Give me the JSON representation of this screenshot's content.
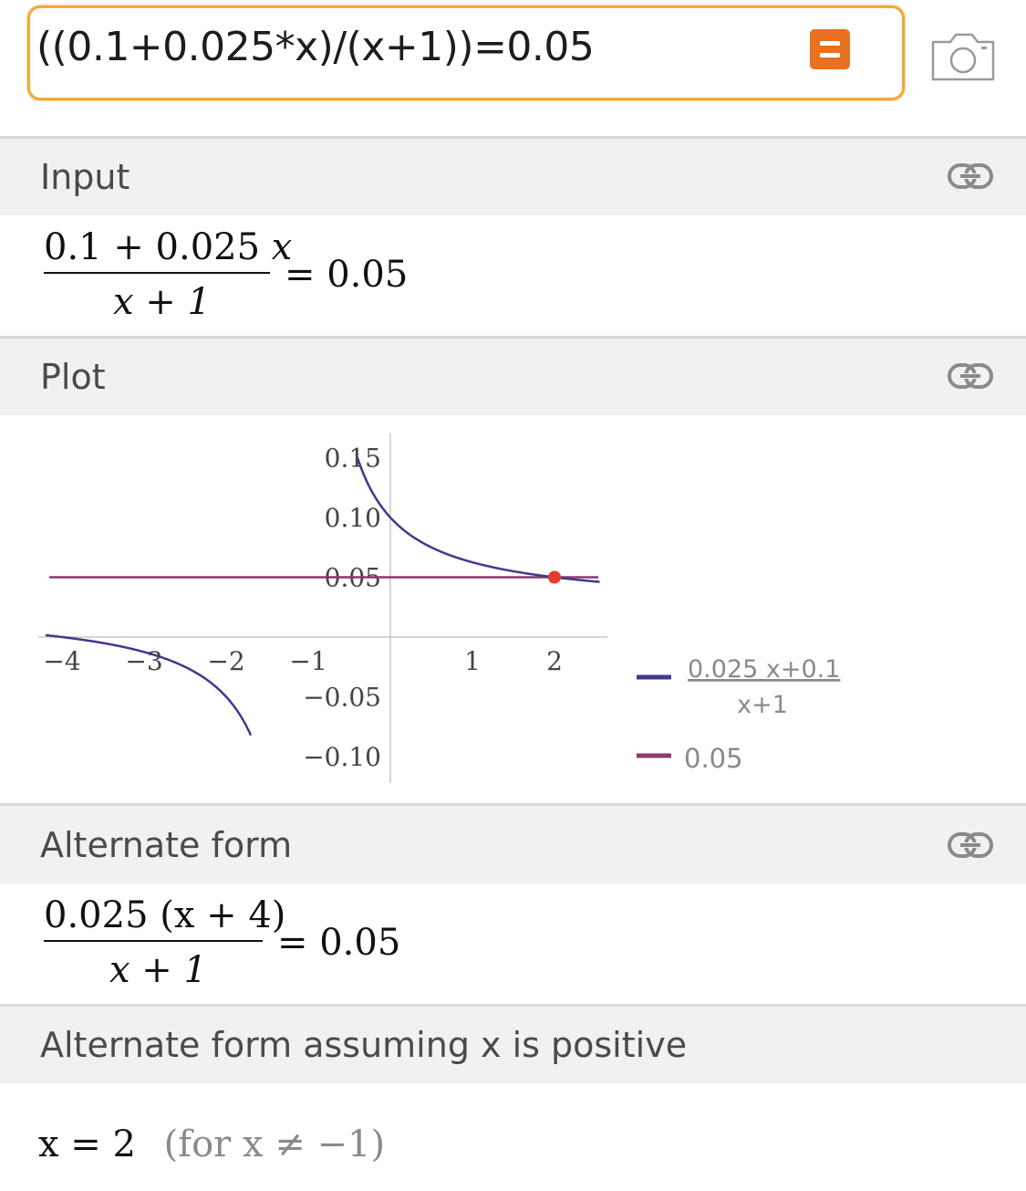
{
  "search": {
    "query": "((0.1+0.025*x)/(x+1))=0.05"
  },
  "pods": {
    "input": {
      "title": "Input",
      "numerator": "0.1 + 0.025",
      "numerator_var": "x",
      "denominator": "x + 1",
      "rhs": "= 0.05"
    },
    "plot": {
      "title": "Plot"
    },
    "alternate_form": {
      "title": "Alternate form",
      "numerator": "0.025 (x + 4)",
      "denominator": "x + 1",
      "rhs": "= 0.05"
    },
    "alternate_positive": {
      "title": "Alternate form assuming x is positive",
      "solution": "x = 2",
      "condition": "(for x ≠ −1)"
    }
  },
  "icons": [
    "equals-icon",
    "camera-icon",
    "link-icon"
  ],
  "colors": {
    "accent_orange": "#e8701f",
    "search_border": "#f2a93b",
    "curve": "#3f3a8c",
    "hline": "#8a3a6e",
    "point": "#e63b2e"
  },
  "chart_data": {
    "type": "line",
    "x_range": [
      -4.2,
      2.7
    ],
    "y_range": [
      -0.11,
      0.155
    ],
    "x_ticks": [
      "−4",
      "−3",
      "−2",
      "−1",
      "1",
      "2"
    ],
    "y_ticks": [
      "0.15",
      "0.10",
      "0.05",
      "−0.05",
      "−0.10"
    ],
    "series": [
      {
        "name_top": "0.025 x+0.1",
        "name_bottom": "x+1",
        "function": "(0.1+0.025*x)/(x+1)",
        "color": "#3f3a8c"
      },
      {
        "name": "0.05",
        "function": "0.05",
        "color": "#8a3a6e"
      }
    ],
    "highlight_point": {
      "x": 2,
      "y": 0.05
    },
    "legend_position": "right"
  }
}
